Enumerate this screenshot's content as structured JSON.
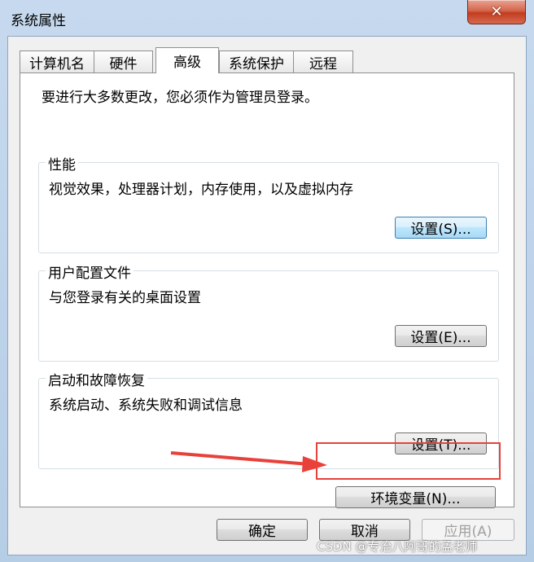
{
  "window": {
    "title": "系统属性",
    "close_glyph": "✕"
  },
  "tabs": [
    {
      "label": "计算机名"
    },
    {
      "label": "硬件"
    },
    {
      "label": "高级",
      "active": true
    },
    {
      "label": "系统保护"
    },
    {
      "label": "远程"
    }
  ],
  "panel": {
    "info": "要进行大多数更改，您必须作为管理员登录。",
    "performance": {
      "title": "性能",
      "desc": "视觉效果，处理器计划，内存使用，以及虚拟内存",
      "button": "设置(S)..."
    },
    "profiles": {
      "title": "用户配置文件",
      "desc": "与您登录有关的桌面设置",
      "button": "设置(E)..."
    },
    "startup": {
      "title": "启动和故障恢复",
      "desc": "系统启动、系统失败和调试信息",
      "button": "设置(T)..."
    },
    "env_button": "环境变量(N)..."
  },
  "footer": {
    "ok": "确定",
    "cancel": "取消",
    "apply": "应用(A)"
  },
  "watermark": "CSDN @专治八阿哥的孟老师",
  "colors": {
    "annotation": "#e8413a",
    "window_frame": "#b9cfe7"
  }
}
